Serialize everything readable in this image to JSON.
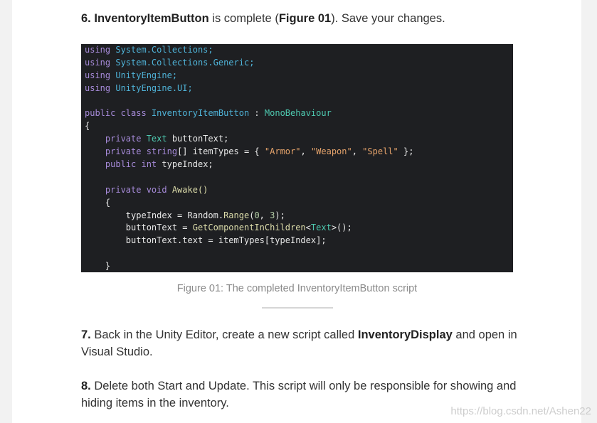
{
  "step6": {
    "num": "6.",
    "class_name": "InventoryItemButton",
    "mid": " is complete (",
    "fig": "Figure 01",
    "end": "). Save your changes."
  },
  "code_lines": [
    [
      {
        "t": "using ",
        "c": "kw2"
      },
      {
        "t": "System.Collections;",
        "c": "ns"
      }
    ],
    [
      {
        "t": "using ",
        "c": "kw2"
      },
      {
        "t": "System.Collections.Generic;",
        "c": "ns"
      }
    ],
    [
      {
        "t": "using ",
        "c": "kw2"
      },
      {
        "t": "UnityEngine;",
        "c": "ns"
      }
    ],
    [
      {
        "t": "using ",
        "c": "kw2"
      },
      {
        "t": "UnityEngine.UI;",
        "c": "ns"
      }
    ],
    [],
    [
      {
        "t": "public class ",
        "c": "kw2"
      },
      {
        "t": "InventoryItemButton",
        "c": "ns"
      },
      {
        "t": " : ",
        "c": "id"
      },
      {
        "t": "MonoBehaviour",
        "c": "ty"
      }
    ],
    [
      {
        "t": "{",
        "c": "id"
      }
    ],
    [
      {
        "t": "    private ",
        "c": "kw2"
      },
      {
        "t": "Text ",
        "c": "ty"
      },
      {
        "t": "buttonText;",
        "c": "id"
      }
    ],
    [
      {
        "t": "    private ",
        "c": "kw2"
      },
      {
        "t": "string",
        "c": "kw2"
      },
      {
        "t": "[] itemTypes = { ",
        "c": "id"
      },
      {
        "t": "\"Armor\"",
        "c": "st"
      },
      {
        "t": ", ",
        "c": "id"
      },
      {
        "t": "\"Weapon\"",
        "c": "st"
      },
      {
        "t": ", ",
        "c": "id"
      },
      {
        "t": "\"Spell\"",
        "c": "st"
      },
      {
        "t": " };",
        "c": "id"
      }
    ],
    [
      {
        "t": "    public ",
        "c": "kw2"
      },
      {
        "t": "int ",
        "c": "kw2"
      },
      {
        "t": "typeIndex;",
        "c": "id"
      }
    ],
    [],
    [
      {
        "t": "    private ",
        "c": "kw2"
      },
      {
        "t": "void ",
        "c": "kw2"
      },
      {
        "t": "Awake()",
        "c": "fn"
      }
    ],
    [
      {
        "t": "    {",
        "c": "id"
      }
    ],
    [
      {
        "t": "        typeIndex = Random.",
        "c": "id"
      },
      {
        "t": "Range",
        "c": "fn"
      },
      {
        "t": "(",
        "c": "id"
      },
      {
        "t": "0",
        "c": "nm"
      },
      {
        "t": ", ",
        "c": "id"
      },
      {
        "t": "3",
        "c": "nm"
      },
      {
        "t": ");",
        "c": "id"
      }
    ],
    [
      {
        "t": "        buttonText = ",
        "c": "id"
      },
      {
        "t": "GetComponentInChildren",
        "c": "fn"
      },
      {
        "t": "<",
        "c": "id"
      },
      {
        "t": "Text",
        "c": "ty"
      },
      {
        "t": ">();",
        "c": "id"
      }
    ],
    [
      {
        "t": "        buttonText.text = itemTypes[typeIndex];",
        "c": "id"
      }
    ],
    [],
    [
      {
        "t": "    }",
        "c": "id"
      }
    ],
    [
      {
        "t": "}",
        "c": "id"
      }
    ]
  ],
  "caption": "Figure 01: The completed InventoryItemButton script",
  "step7": {
    "num": "7.",
    "pre": " Back in the Unity Editor, create a new script called ",
    "name": "InventoryDisplay",
    "post": " and open in Visual Studio."
  },
  "step8": {
    "num": "8.",
    "text": " Delete both Start and Update. This script will only be responsible for showing and hiding items in the inventory."
  },
  "watermark": "https://blog.csdn.net/Ashen22"
}
